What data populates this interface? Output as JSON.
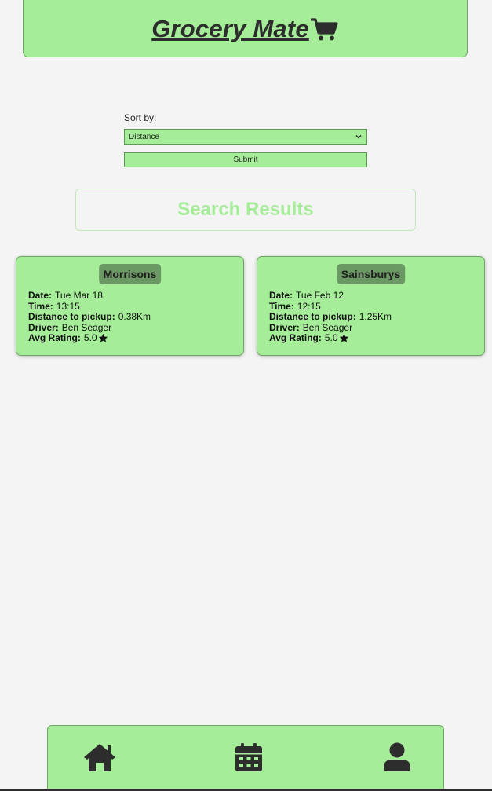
{
  "header": {
    "title": "Grocery Mate",
    "icon": "shopping-cart-icon"
  },
  "sort": {
    "label": "Sort by:",
    "selected": "Distance",
    "submit_label": "Submit"
  },
  "results": {
    "heading": "Search Results",
    "cards": [
      {
        "store": "Morrisons",
        "date_label": "Date:",
        "date": "Tue Mar 18",
        "time_label": "Time:",
        "time": "13:15",
        "distance_label": "Distance to pickup:",
        "distance": "0.38Km",
        "driver_label": "Driver:",
        "driver": "Ben Seager",
        "rating_label": "Avg Rating:",
        "rating": "5.0"
      },
      {
        "store": "Sainsburys",
        "date_label": "Date:",
        "date": "Tue Feb 12",
        "time_label": "Time:",
        "time": "12:15",
        "distance_label": "Distance to pickup:",
        "distance": "1.25Km",
        "driver_label": "Driver:",
        "driver": "Ben Seager",
        "rating_label": "Avg Rating:",
        "rating": "5.0"
      }
    ]
  },
  "nav": {
    "items": [
      {
        "name": "home",
        "icon": "home-icon"
      },
      {
        "name": "calendar",
        "icon": "calendar-icon"
      },
      {
        "name": "profile",
        "icon": "user-icon"
      }
    ]
  },
  "colors": {
    "accent": "#a6ed99",
    "badge": "#6b9963",
    "background": "#f4f4f4",
    "text": "#2d2d2d"
  }
}
